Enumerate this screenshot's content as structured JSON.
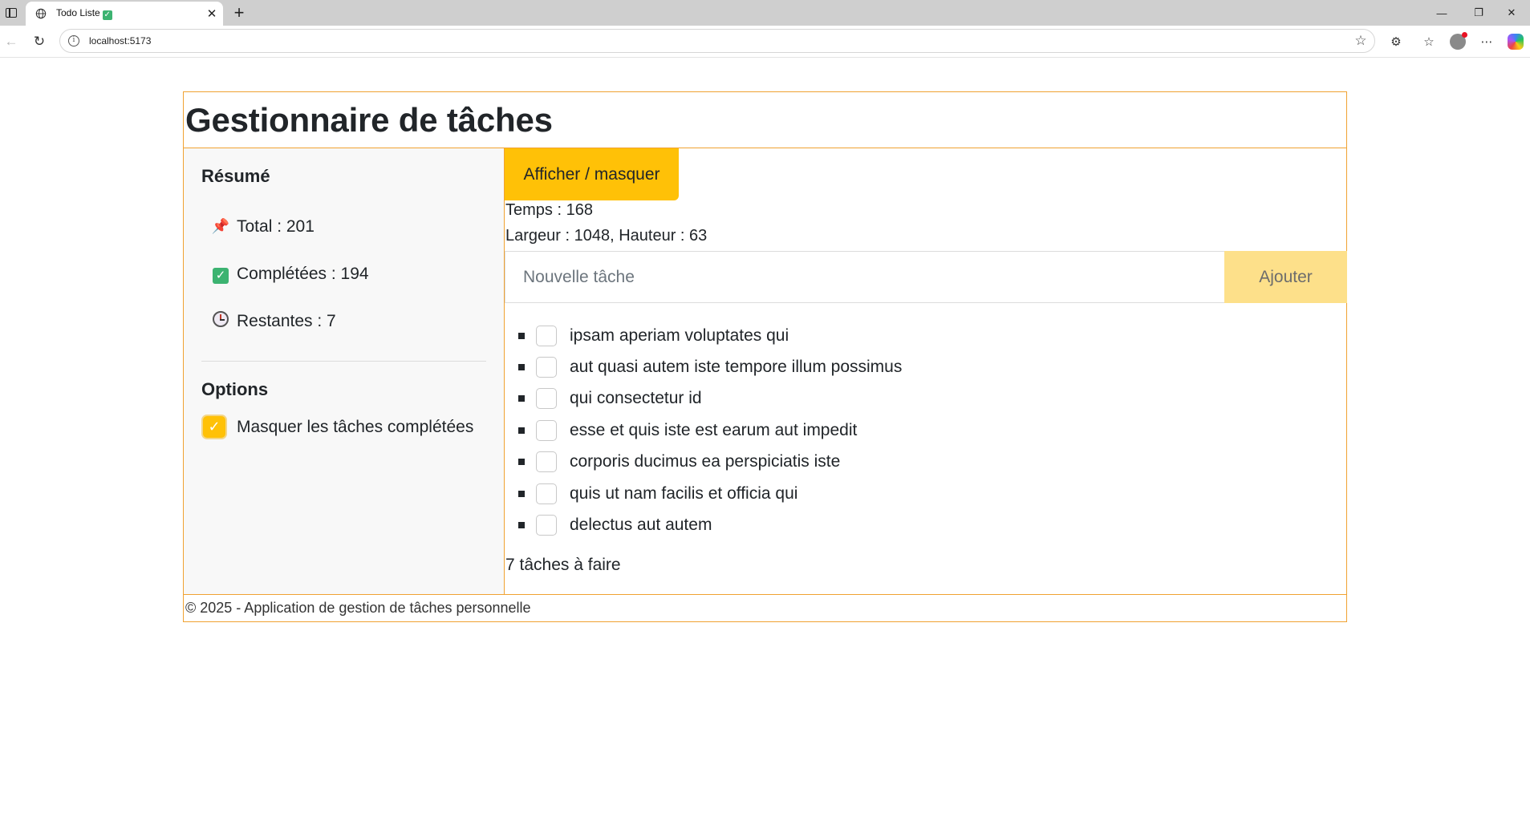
{
  "browser": {
    "tab_title": "Todo Liste",
    "tab_close": "✕",
    "new_tab": "+",
    "url": "localhost:5173",
    "window_controls": {
      "minimize": "—",
      "restore": "❐",
      "close": "✕"
    },
    "icons": [
      "sidebar-toggle-icon",
      "globe-icon",
      "back-arrow-icon",
      "reload-icon",
      "info-icon",
      "favorite-star-icon",
      "extensions-icon",
      "favorites-icon",
      "profile-icon",
      "more-icon",
      "copilot-icon"
    ]
  },
  "app": {
    "title": "Gestionnaire de tâches",
    "summary": {
      "heading": "Résumé",
      "total": "Total : 201",
      "completed": "Complétées : 194",
      "remaining": "Restantes : 7"
    },
    "options": {
      "heading": "Options",
      "hide_completed_label": "Masquer les tâches complétées",
      "hide_completed_checked": true
    },
    "toggle_button": "Afficher / masquer",
    "time_text": "Temps : 168",
    "size_text": "Largeur : 1048, Hauteur : 63",
    "new_task_placeholder": "Nouvelle tâche",
    "add_button": "Ajouter",
    "tasks": [
      "ipsam aperiam voluptates qui",
      "aut quasi autem iste tempore illum possimus",
      "qui consectetur id",
      "esse et quis iste est earum aut impedit",
      "corporis ducimus ea perspiciatis iste",
      "quis ut nam facilis et officia qui",
      "delectus aut autem"
    ],
    "remaining_count_text": "7 tâches à faire",
    "footer": "© 2025 - Application de gestion de tâches personnelle"
  },
  "colors": {
    "accent": "#ffc107",
    "border": "#f0a232",
    "add_button": "#fde08a",
    "sidebar_bg": "#f8f8f8"
  }
}
